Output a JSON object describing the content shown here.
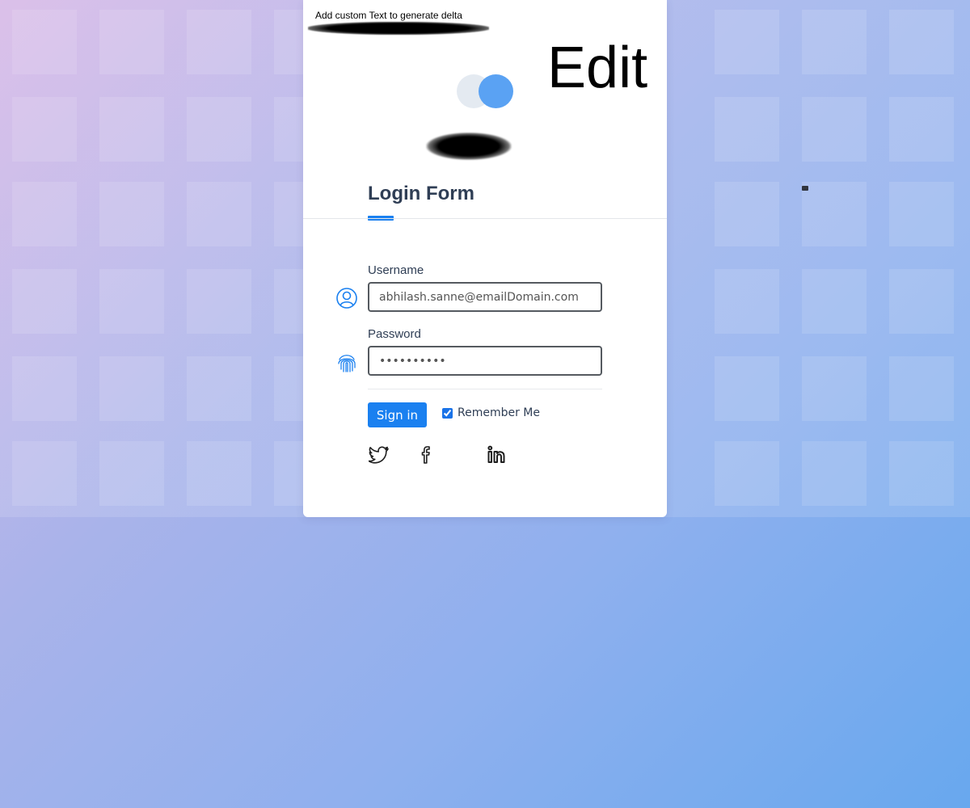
{
  "overlay": {
    "custom_text": "Add custom Text to generate delta",
    "edit_label": "Edit"
  },
  "login": {
    "title": "Login Form",
    "username_label": "Username",
    "username_value": "abhilash.sanne@emailDomain.com",
    "password_label": "Password",
    "password_value": "••••••••••",
    "sign_in_label": "Sign in",
    "remember_label": "Remember Me",
    "remember_checked": true
  },
  "icons": {
    "username": "user-circle-icon",
    "password": "fingerprint-icon",
    "social": [
      "twitter-icon",
      "facebook-icon",
      "linkedin-icon"
    ]
  },
  "colors": {
    "accent": "#1a80f0",
    "logo": "#5aa2f3",
    "title": "#2f3e55"
  }
}
